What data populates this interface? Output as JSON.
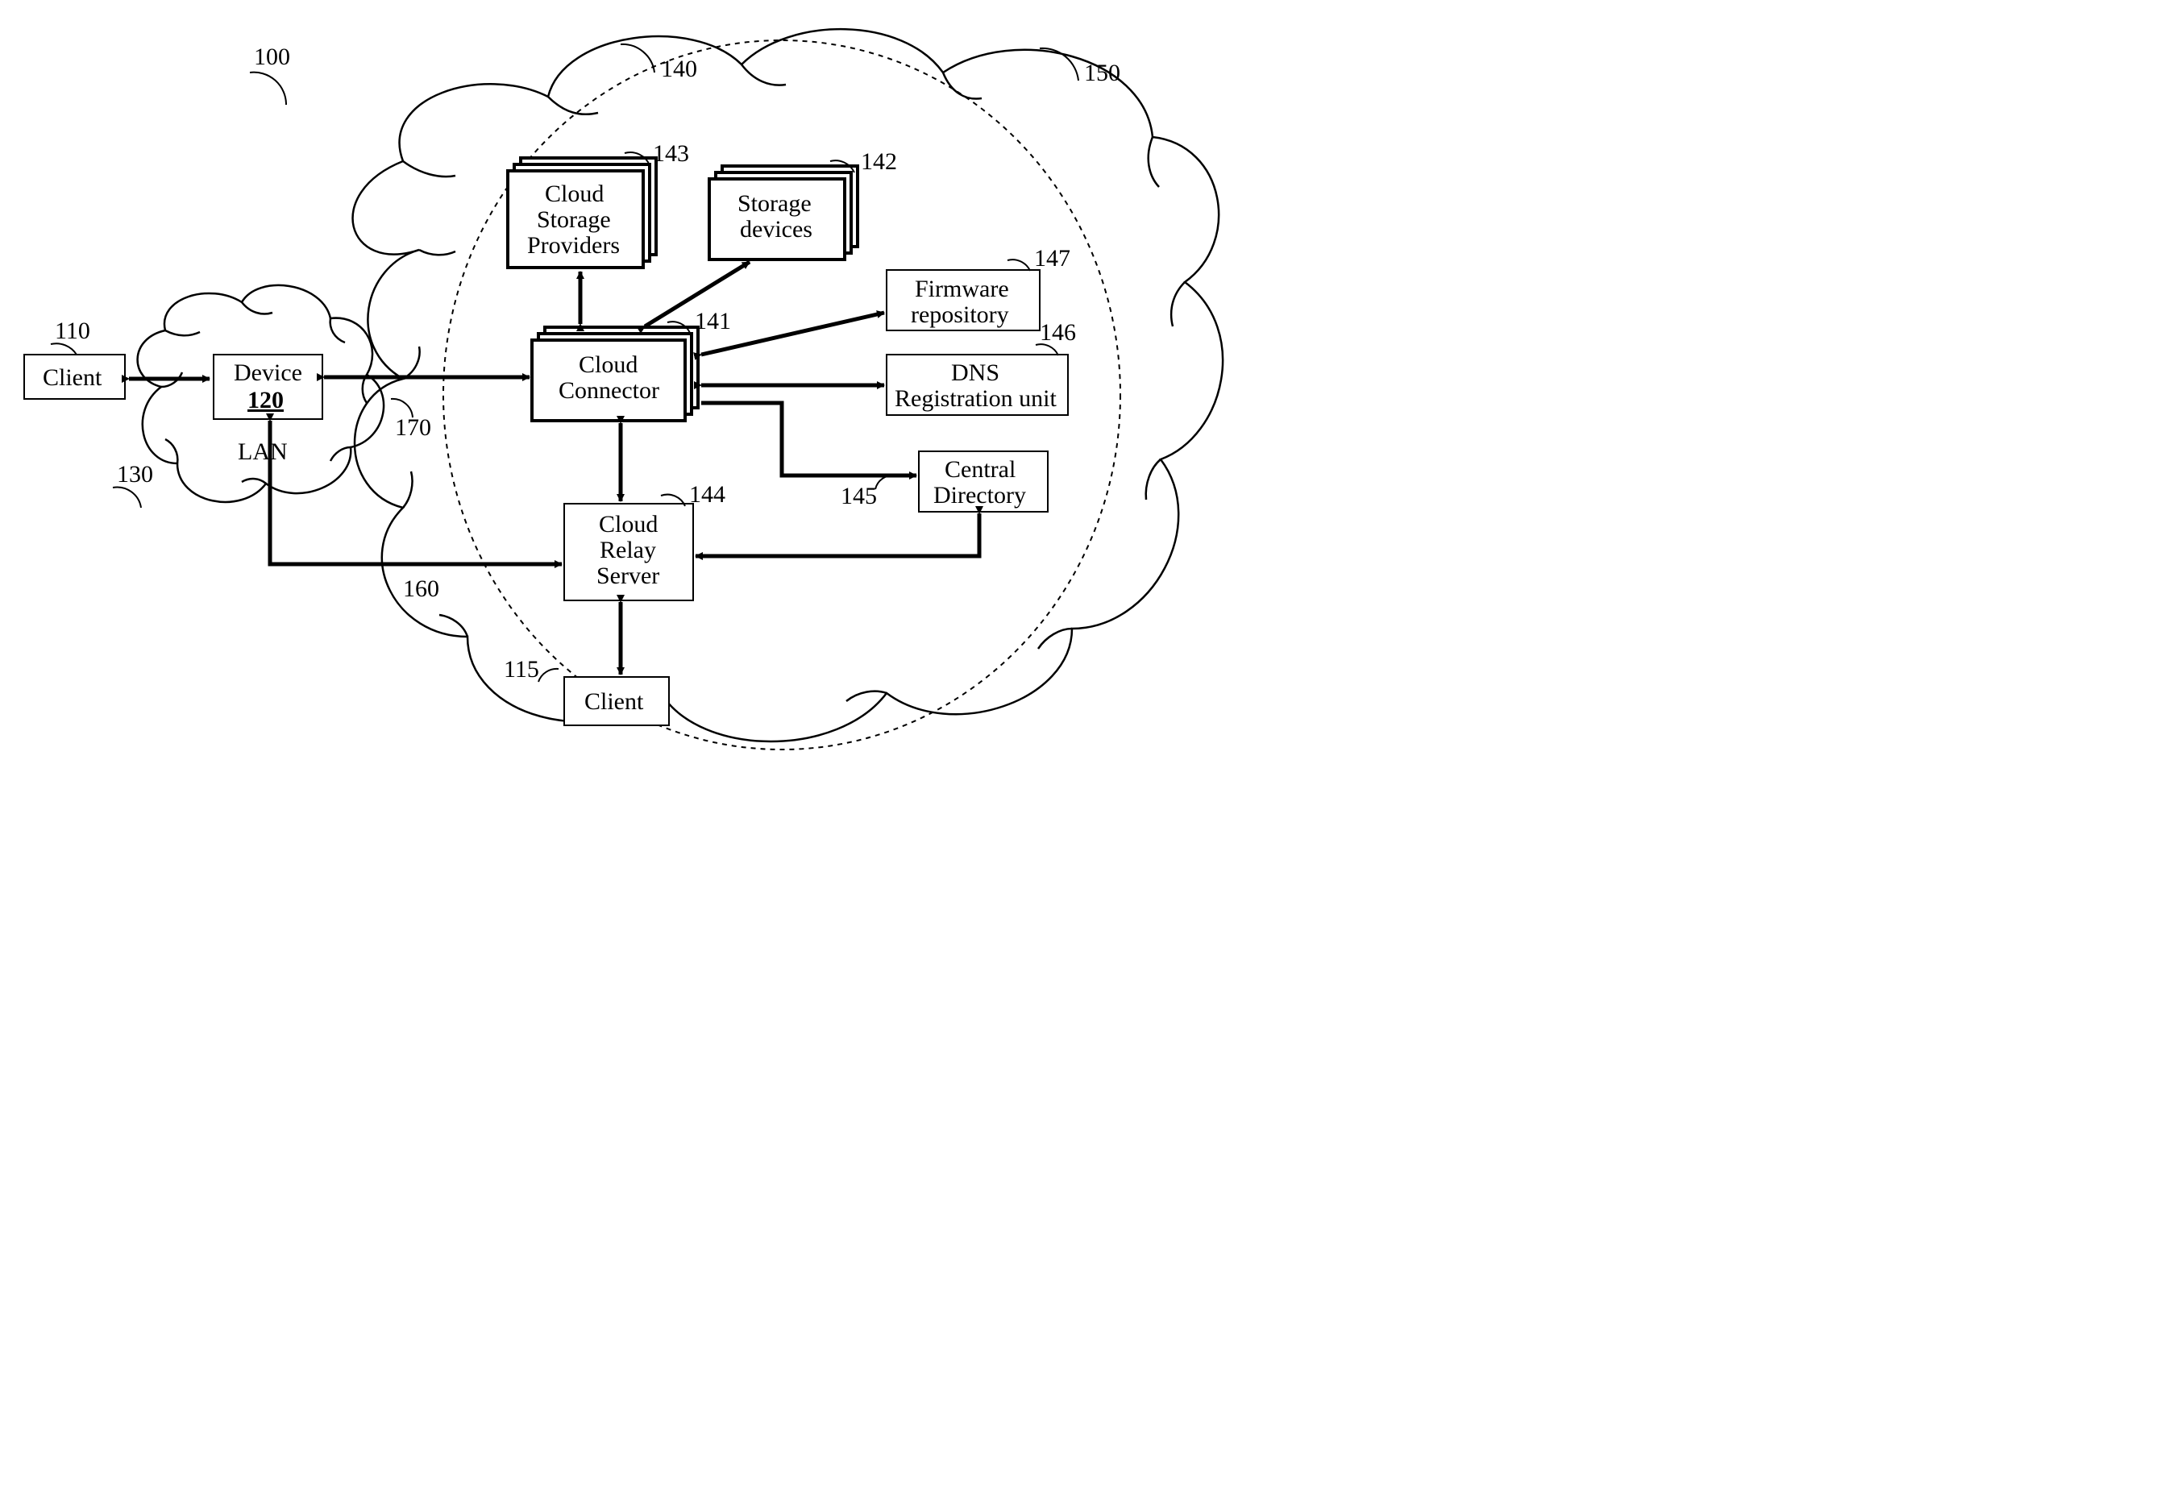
{
  "refs": {
    "r100": "100",
    "r110": "110",
    "r115": "115",
    "r120": "120",
    "r130": "130",
    "r140": "140",
    "r141": "141",
    "r142": "142",
    "r143": "143",
    "r144": "144",
    "r145": "145",
    "r146": "146",
    "r147": "147",
    "r150": "150",
    "r160": "160",
    "r170": "170"
  },
  "labels": {
    "client_left": "Client",
    "client_bottom": "Client",
    "device": "Device",
    "device_num": "120",
    "lan": "LAN",
    "cloud_storage_providers_l1": "Cloud",
    "cloud_storage_providers_l2": "Storage",
    "cloud_storage_providers_l3": "Providers",
    "storage_devices_l1": "Storage",
    "storage_devices_l2": "devices",
    "cloud_connector_l1": "Cloud",
    "cloud_connector_l2": "Connector",
    "cloud_relay_server_l1": "Cloud",
    "cloud_relay_server_l2": "Relay",
    "cloud_relay_server_l3": "Server",
    "firmware_repo_l1": "Firmware",
    "firmware_repo_l2": "repository",
    "dns_reg_l1": "DNS",
    "dns_reg_l2": "Registration unit",
    "central_dir_l1": "Central",
    "central_dir_l2": "Directory"
  }
}
